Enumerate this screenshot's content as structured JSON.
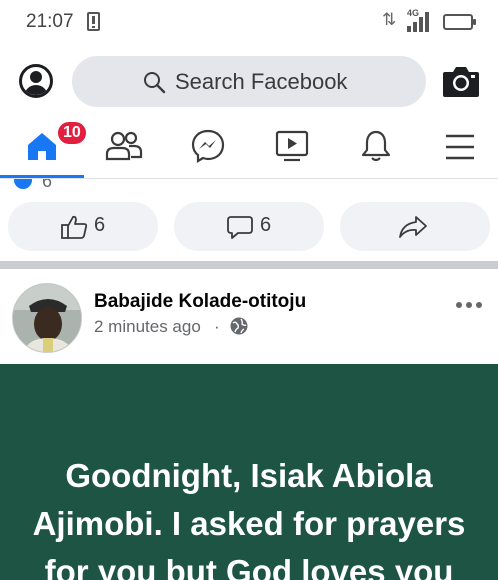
{
  "status_bar": {
    "time": "21:07",
    "network_type": "4G",
    "arrows": "⇅"
  },
  "header": {
    "search_placeholder": "Search Facebook",
    "profile_icon": "profile-icon",
    "camera_icon": "camera-icon"
  },
  "tabs": [
    {
      "name": "home",
      "icon": "home-icon",
      "badge": "10",
      "active": true
    },
    {
      "name": "friends",
      "icon": "friends-icon"
    },
    {
      "name": "messenger",
      "icon": "messenger-icon"
    },
    {
      "name": "watch",
      "icon": "watch-icon"
    },
    {
      "name": "notifications",
      "icon": "bell-icon"
    },
    {
      "name": "menu",
      "icon": "menu-icon"
    }
  ],
  "previous_post": {
    "reaction_count_partial": "6",
    "like_count": "6",
    "comment_count": "6"
  },
  "post": {
    "author": "Babajide Kolade-otitoju",
    "time": "2 minutes ago",
    "separator": "·",
    "privacy_icon": "globe-icon",
    "text": "Goodnight, Isiak Abiola Ajimobi. I asked for prayers for you but God loves you",
    "background_color": "#1e5444"
  },
  "colors": {
    "accent": "#1877f2",
    "badge": "#e41e3f"
  }
}
